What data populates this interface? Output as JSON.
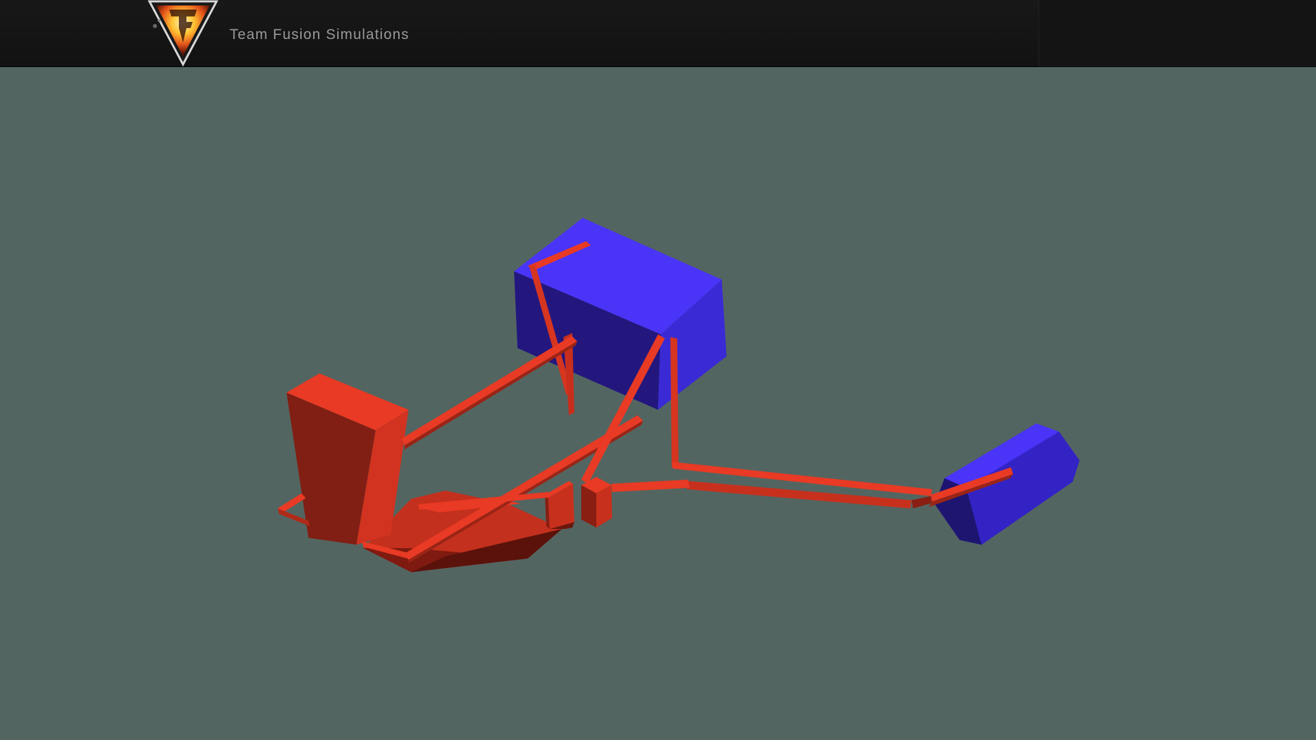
{
  "app": {
    "brand_title": "Team Fusion Simulations"
  },
  "icons": {
    "logo": "tfs-flame-triangle-logo"
  },
  "colors": {
    "background": "#536561",
    "header": "#151515",
    "part_red": "#e83a24",
    "part_blue": "#3d2cf0"
  }
}
